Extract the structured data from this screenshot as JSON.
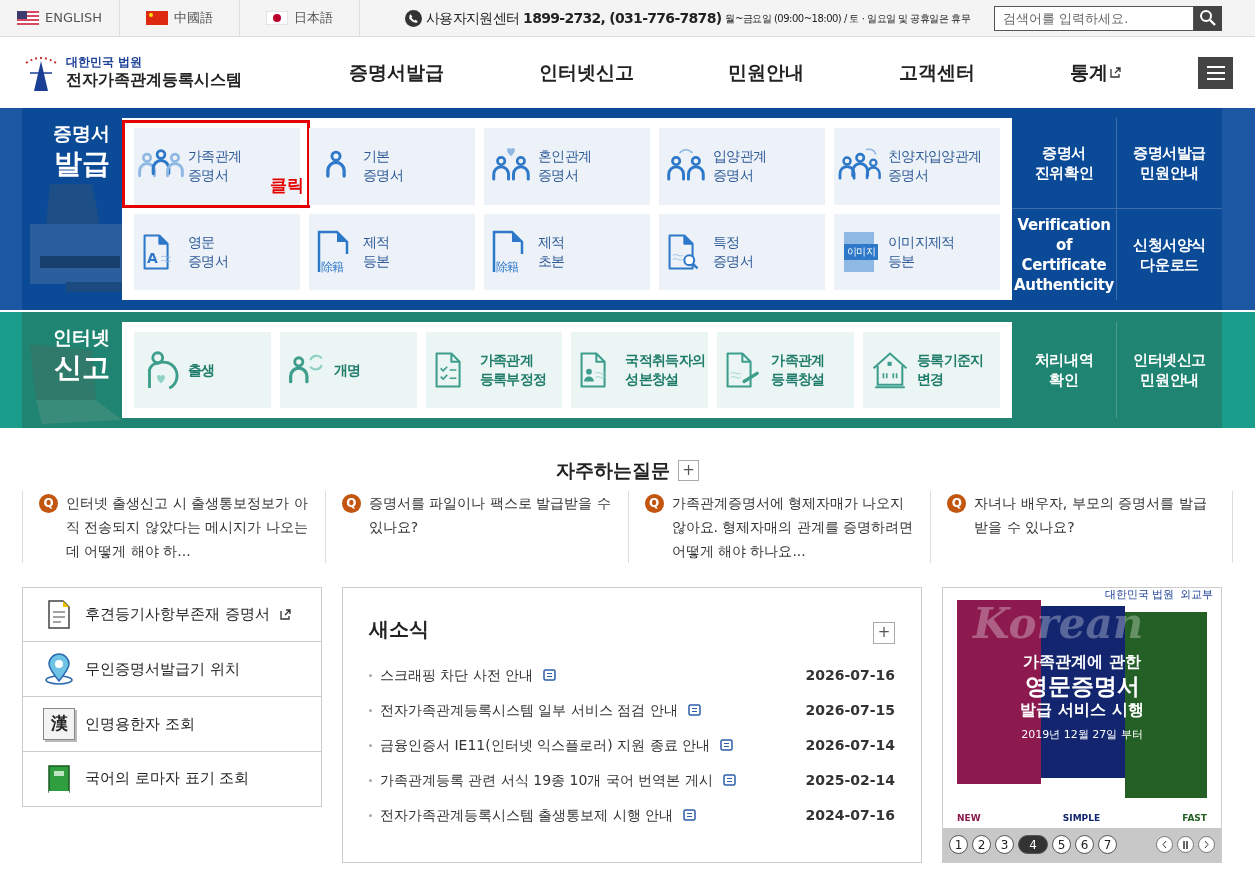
{
  "languages": [
    {
      "label": "ENGLISH",
      "kind": "us"
    },
    {
      "label": "中國語",
      "kind": "cn"
    },
    {
      "label": "日本語",
      "kind": "jp"
    }
  ],
  "support": {
    "label": "사용자지원센터",
    "phone": "1899-2732, (031-776-7878)",
    "hours": "월~금요일 (09:00~18:00) / 토 · 일요일 및 공휴일은 휴무"
  },
  "search": {
    "placeholder": "검색어를 입력하세요."
  },
  "logo": {
    "court": "대한민국 법원",
    "system": "전자가족관계등록시스템"
  },
  "nav": [
    {
      "label": "증명서발급",
      "external": false
    },
    {
      "label": "인터넷신고",
      "external": false
    },
    {
      "label": "민원안내",
      "external": false
    },
    {
      "label": "고객센터",
      "external": false
    },
    {
      "label": "통계",
      "external": true
    }
  ],
  "certificates": {
    "title_small": "증명서",
    "title_big": "발급",
    "tiles": [
      {
        "lines": [
          "가족관계",
          "증명서"
        ],
        "kind": "family",
        "highlighted": true,
        "note": "클릭"
      },
      {
        "lines": [
          "기본",
          "증명서"
        ],
        "kind": "person",
        "highlighted": false
      },
      {
        "lines": [
          "혼인관계",
          "증명서"
        ],
        "kind": "marriage",
        "highlighted": false
      },
      {
        "lines": [
          "입양관계",
          "증명서"
        ],
        "kind": "adoption",
        "highlighted": false
      },
      {
        "lines": [
          "친양자입양관계",
          "증명서"
        ],
        "kind": "adoption3",
        "highlighted": false
      },
      {
        "lines": [
          "영문",
          "증명서"
        ],
        "kind": "english",
        "highlighted": false,
        "glyph": "A"
      },
      {
        "lines": [
          "제적",
          "등본"
        ],
        "kind": "removed",
        "highlighted": false,
        "glyph": "除籍"
      },
      {
        "lines": [
          "제적",
          "초본"
        ],
        "kind": "removed",
        "highlighted": false,
        "glyph": "除籍"
      },
      {
        "lines": [
          "특정",
          "증명서"
        ],
        "kind": "search",
        "highlighted": false
      },
      {
        "lines": [
          "이미지제적",
          "등본"
        ],
        "kind": "image",
        "highlighted": false,
        "glyph": "이미지"
      }
    ],
    "links": [
      {
        "lines": [
          "증명서",
          "진위확인"
        ]
      },
      {
        "lines": [
          "증명서발급",
          "민원안내"
        ]
      },
      {
        "lines": [
          "Verification of",
          "Certificate",
          "Authenticity"
        ]
      },
      {
        "lines": [
          "신청서양식",
          "다운로드"
        ]
      }
    ]
  },
  "reports": {
    "title_small": "인터넷",
    "title_big": "신고",
    "tiles": [
      {
        "lines": [
          "출생"
        ],
        "kind": "birth"
      },
      {
        "lines": [
          "개명"
        ],
        "kind": "rename"
      },
      {
        "lines": [
          "가족관계",
          "등록부정정"
        ],
        "kind": "checklist"
      },
      {
        "lines": [
          "국적취득자의",
          "성본창설"
        ],
        "kind": "profile"
      },
      {
        "lines": [
          "가족관계",
          "등록창설"
        ],
        "kind": "pen"
      },
      {
        "lines": [
          "등록기준지",
          "변경"
        ],
        "kind": "house"
      }
    ],
    "links": [
      {
        "lines": [
          "처리내역",
          "확인"
        ]
      },
      {
        "lines": [
          "인터넷신고",
          "민원안내"
        ]
      }
    ]
  },
  "faq": {
    "title": "자주하는질문",
    "more": "+",
    "items": [
      {
        "mark": "Q",
        "text": "인터넷 출생신고 시 출생통보정보가 아직 전송되지 않았다는 메시지가 나오는데 어떻게 해야 하..."
      },
      {
        "mark": "Q",
        "text": "증명서를 파일이나 팩스로 발급받을 수 있나요?"
      },
      {
        "mark": "Q",
        "text": "가족관계증명서에 형제자매가 나오지 않아요. 형제자매의 관계를 증명하려면 어떻게 해야 하나요..."
      },
      {
        "mark": "Q",
        "text": "자녀나 배우자, 부모의 증명서를 발급 받을 수 있나요?"
      }
    ]
  },
  "quick_links": [
    {
      "label": "후견등기사항부존재 증명서",
      "kind": "document",
      "external": true
    },
    {
      "label": "무인증명서발급기 위치",
      "kind": "pin",
      "external": false
    },
    {
      "label": "인명용한자 조회",
      "kind": "hanja",
      "glyph": "漢",
      "external": false
    },
    {
      "label": "국어의 로마자 표기 조회",
      "kind": "book",
      "external": false
    }
  ],
  "news": {
    "title": "새소식",
    "more": "+",
    "items": [
      {
        "title": "스크래핑 차단 사전 안내",
        "date": "2026-07-16"
      },
      {
        "title": "전자가족관계등록시스템 일부 서비스 점검 안내",
        "date": "2026-07-15"
      },
      {
        "title": "금융인증서 IE11(인터넷 익스플로러) 지원 종료 안내",
        "date": "2026-07-14"
      },
      {
        "title": "가족관계등록 관련 서식 19종 10개 국어 번역본 게시",
        "date": "2025-02-14"
      },
      {
        "title": "전자가족관계등록시스템 출생통보제 시행 안내",
        "date": "2024-07-16"
      }
    ]
  },
  "banner": {
    "logos": [
      "대한민국 법원",
      "외교부"
    ],
    "script": "Korean",
    "headline": [
      "가족관계에 관한",
      "영문증명서",
      "발급 서비스 시행"
    ],
    "date": "2019년 12월 27일 부터",
    "features": [
      "NEW",
      "SIMPLE",
      "FAST"
    ],
    "pages": [
      {
        "label": "1",
        "selected": false
      },
      {
        "label": "2",
        "selected": false
      },
      {
        "label": "3",
        "selected": false
      },
      {
        "label": "4",
        "selected": true
      },
      {
        "label": "5",
        "selected": false
      },
      {
        "label": "6",
        "selected": false
      },
      {
        "label": "7",
        "selected": false
      }
    ]
  }
}
